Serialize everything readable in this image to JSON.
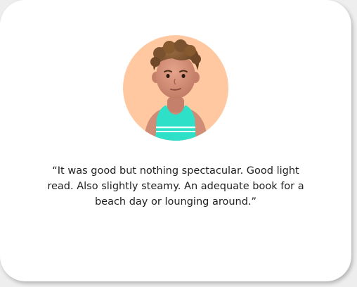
{
  "testimonial": {
    "quote": "“It was good but nothing spectacular. Good light read. Also slightly steamy. An adequate book for a beach day or lounging around.”",
    "avatar": {
      "icon": "person-avatar-icon",
      "background_color": "#ffc8a0",
      "shirt_color": "#2ee0c8",
      "skin_color": "#d4907a",
      "hair_color": "#7a5230"
    }
  }
}
